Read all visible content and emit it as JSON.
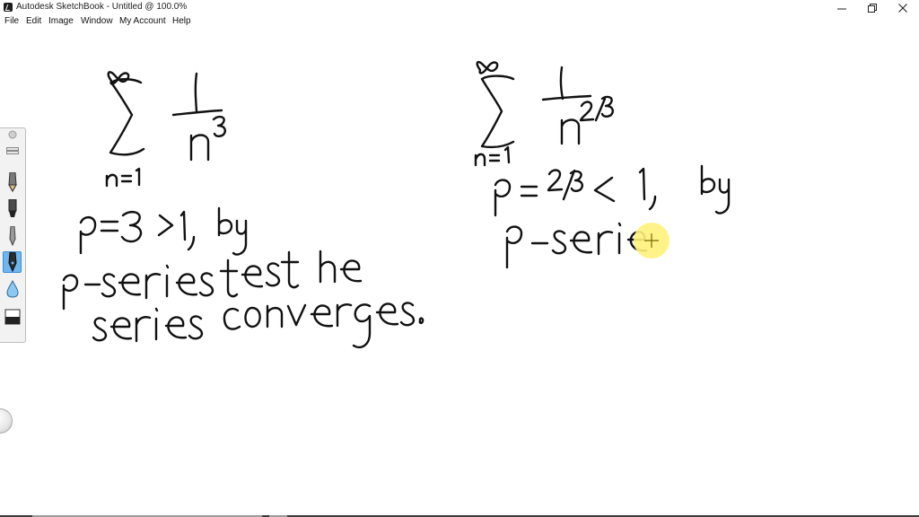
{
  "window": {
    "title": "Autodesk SketchBook - Untitled @ 100.0%"
  },
  "menu": {
    "items": [
      {
        "label": "File"
      },
      {
        "label": "Edit"
      },
      {
        "label": "Image"
      },
      {
        "label": "Window"
      },
      {
        "label": "My Account"
      },
      {
        "label": "Help"
      }
    ]
  },
  "toolbar": {
    "tools": [
      {
        "icon": "collapse-handle-icon"
      },
      {
        "icon": "toolbar-grip-icon"
      },
      {
        "icon": "pencil-icon"
      },
      {
        "icon": "marker-icon"
      },
      {
        "icon": "pen-icon"
      },
      {
        "icon": "ink-pen-icon",
        "active": true
      },
      {
        "icon": "water-drop-icon"
      },
      {
        "icon": "eraser-icon"
      }
    ]
  },
  "cursor": {
    "highlight_color": "#fff27a"
  },
  "colors": {
    "ink": "#111111",
    "active_tool": "#6fb6f1"
  }
}
